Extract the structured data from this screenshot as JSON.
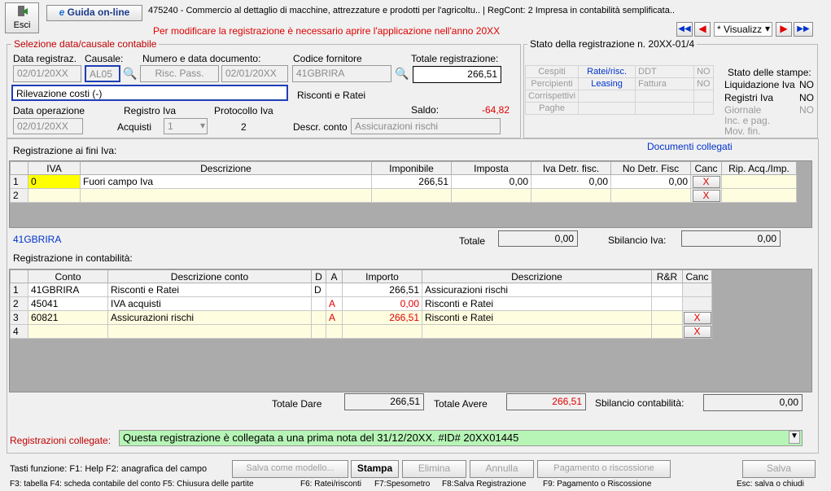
{
  "toolbar": {
    "exit_label": "Esci",
    "guide_label": "Guida on-line",
    "company_info": "475240 - Commercio al dettaglio di macchine, attrezzature e prodotti per l'agricoltu.. | RegCont: 2 Impresa  in contabilità semplificata..",
    "warning": "Per modificare la registrazione è necessario aprire l'applicazione nell'anno 20XX",
    "view_select": "* Visualizz"
  },
  "selection": {
    "title": "Selezione data/causale contabile",
    "date_label": "Data registraz.",
    "date_value": "02/01/20XX",
    "causale_label": "Causale:",
    "causale_value": "AL05",
    "doc_label": "Numero e data documento:",
    "doc_number": "Risc. Pass.",
    "doc_date": "02/01/20XX",
    "description": "Rilevazione costi (-)",
    "op_date_label": "Data operazione",
    "op_date_value": "02/01/20XX",
    "iva_register_label": "Registro Iva",
    "iva_register_type": "Acquisti",
    "iva_register_value": "1",
    "protocol_label": "Protocollo Iva",
    "protocol_value": "2",
    "supplier_label": "Codice fornitore",
    "supplier_value": "41GBRIRA",
    "supplier_name": "Risconti e Ratei",
    "total_label": "Totale registrazione:",
    "total_value": "266,51",
    "balance_label": "Saldo:",
    "balance_value": "-64,82",
    "account_desc_label": "Descr. conto",
    "account_desc_value": "Assicurazioni rischi"
  },
  "status": {
    "title": "Stato della registrazione n. 20XX-01/4",
    "rows": [
      {
        "a": "Cespiti",
        "b": "Ratei/risc.",
        "c": "DDT",
        "d": "NO"
      },
      {
        "a": "Percipienti",
        "b": "Leasing",
        "c": "Fattura",
        "d": "NO"
      },
      {
        "a": "Corrispettivi",
        "b": "",
        "c": "",
        "d": ""
      },
      {
        "a": "Paghe",
        "b": "",
        "c": "",
        "d": ""
      }
    ],
    "prints_title": "Stato delle stampe:",
    "prints": [
      {
        "label": "Liquidazione Iva",
        "value": "NO"
      },
      {
        "label": "Registri Iva",
        "value": "NO"
      },
      {
        "label": "Giornale",
        "value": "NO"
      },
      {
        "label": "Inc. e pag.",
        "value": ""
      },
      {
        "label": "Mov. fin.",
        "value": ""
      }
    ]
  },
  "iva": {
    "title": "Registrazione ai fini Iva:",
    "linked_docs": "Documenti collegati",
    "headers": [
      "IVA",
      "Descrizione",
      "Imponibile",
      "Imposta",
      "Iva Detr. fisc.",
      "No Detr. Fisc",
      "Canc",
      "Rip. Acq./Imp."
    ],
    "rows": [
      {
        "n": "1",
        "iva": "0",
        "desc": "Fuori campo Iva",
        "imponibile": "266,51",
        "imposta": "0,00",
        "detr": "0,00",
        "nodetr": "0,00",
        "canc": "X",
        "rip": ""
      },
      {
        "n": "2",
        "iva": "",
        "desc": "",
        "imponibile": "",
        "imposta": "",
        "detr": "",
        "nodetr": "",
        "canc": "X",
        "rip": ""
      }
    ],
    "account_code": "41GBRIRA",
    "total_label": "Totale",
    "total_value": "0,00",
    "imbalance_label": "Sbilancio Iva:",
    "imbalance_value": "0,00"
  },
  "accounting": {
    "title": "Registrazione in contabilità:",
    "headers": [
      "Conto",
      "Descrizione conto",
      "D",
      "A",
      "Importo",
      "Descrizione",
      "R&R",
      "Canc"
    ],
    "rows": [
      {
        "n": "1",
        "conto": "41GBRIRA",
        "desc_conto": "Risconti e Ratei",
        "d": "D",
        "a": "",
        "importo": "266,51",
        "desc": "Assicurazioni rischi",
        "rr": "",
        "canc": ""
      },
      {
        "n": "2",
        "conto": "45041",
        "desc_conto": "IVA acquisti",
        "d": "",
        "a": "A",
        "importo": "0,00",
        "desc": "Risconti e Ratei",
        "rr": "",
        "canc": ""
      },
      {
        "n": "3",
        "conto": "60821",
        "desc_conto": "Assicurazioni rischi",
        "d": "",
        "a": "A",
        "importo": "266,51",
        "desc": "Risconti e Ratei",
        "rr": "",
        "canc": "X"
      },
      {
        "n": "4",
        "conto": "",
        "desc_conto": "",
        "d": "",
        "a": "",
        "importo": "",
        "desc": "",
        "rr": "",
        "canc": "X"
      }
    ],
    "total_dare_label": "Totale Dare",
    "total_dare_value": "266,51",
    "total_avere_label": "Totale Avere",
    "total_avere_value": "266,51",
    "imbalance_label": "Sbilancio contabilità:",
    "imbalance_value": "0,00"
  },
  "linked": {
    "label": "Registrazioni collegate:",
    "value": "Questa registrazione è collegata a una prima nota del 31/12/20XX. #ID# 20XX01445"
  },
  "footer": {
    "keys_line1": "Tasti funzione: F1: Help  F2: anagrafica del campo",
    "keys_line2": "F3: tabella   F4: scheda contabile del conto  F5: Chiusura delle partite",
    "keys_f6": "F6: Ratei/risconti",
    "keys_f7": "F7:Spesometro",
    "keys_f8": "F8:Salva Registrazione",
    "keys_f9": "F9: Pagamento o Riscossione",
    "keys_esc": "Esc: salva o chiudi",
    "btn_save_model": "Salva come modello...",
    "btn_print": "Stampa",
    "btn_delete": "Elimina",
    "btn_cancel": "Annulla",
    "btn_payment": "Pagamento o riscossione",
    "btn_save": "Salva"
  }
}
